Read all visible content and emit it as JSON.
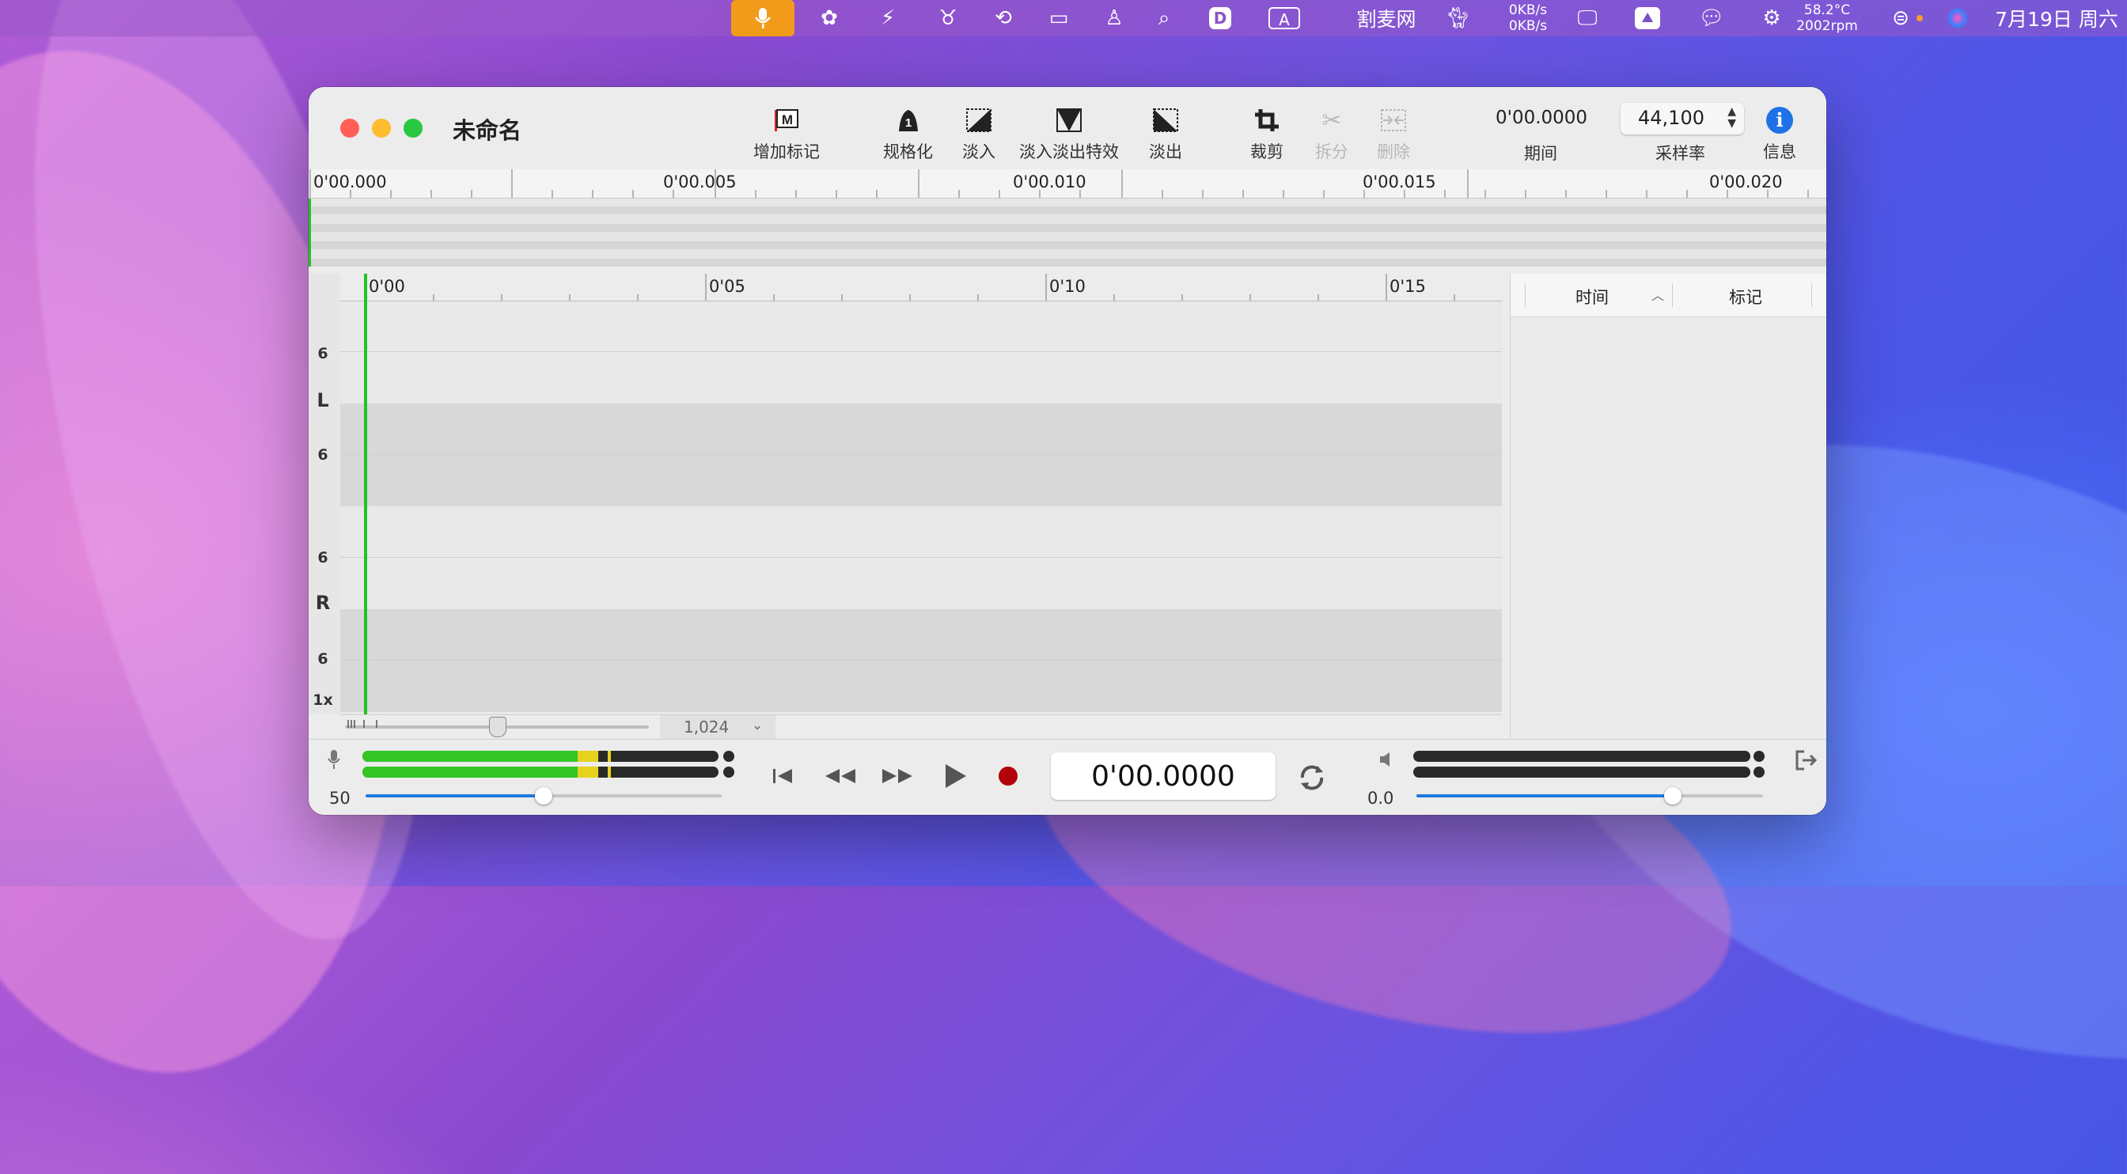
{
  "menubar": {
    "network_up": "0KB/s",
    "network_down": "0KB/s",
    "app_name": "割麦网",
    "temperature": "58.2°C",
    "fan_speed": "2002rpm",
    "datetime": "7月19日 周六",
    "input_source": "A"
  },
  "window": {
    "title": "未命名",
    "toolbar": {
      "add_marker": "增加标记",
      "normalize": "规格化",
      "fade_in": "淡入",
      "crossfade": "淡入淡出特效",
      "fade_out": "淡出",
      "trim": "裁剪",
      "split": "拆分",
      "delete": "删除",
      "duration_value": "0'00.0000",
      "duration_label": "期间",
      "sample_rate_value": "44,100",
      "sample_rate_label": "采样率",
      "info_label": "信息"
    },
    "overview_ruler": [
      "0'00.000",
      "0'00.005",
      "0'00.010",
      "0'00.015",
      "0'00.020"
    ],
    "main_ruler": [
      "0'00",
      "0'05",
      "0'10",
      "0'15"
    ],
    "axis": {
      "left_top": "6",
      "left_label": "L",
      "left_bottom": "6",
      "right_top": "6",
      "right_label": "R",
      "right_bottom": "6",
      "zoom": "1x"
    },
    "zoom_value": "1,024",
    "markers_panel": {
      "col_time": "时间",
      "col_marker": "标记"
    },
    "transport": {
      "input_level": "50",
      "input_volume": 0.5,
      "time": "0'00.0000",
      "output_level": "0.0",
      "output_volume": 0.74
    }
  }
}
